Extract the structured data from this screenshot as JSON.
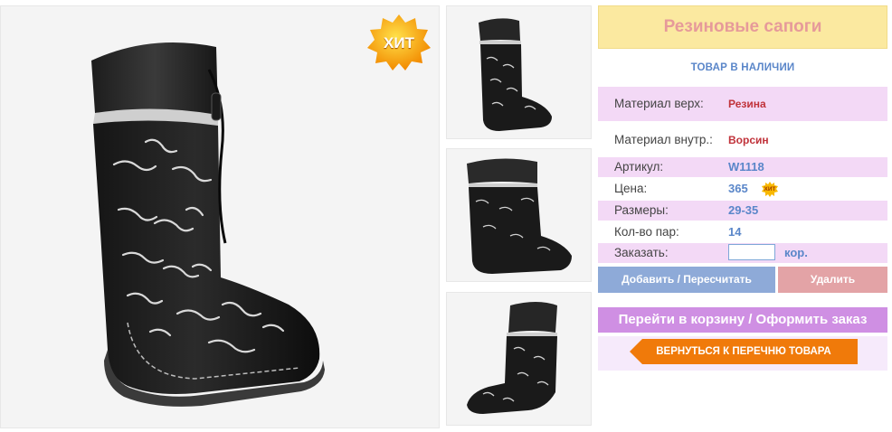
{
  "product": {
    "title": "Резиновые сапоги",
    "stock_status": "ТОВАР В НАЛИЧИИ",
    "hit_badge": "ХИТ",
    "main_image": "black-rubber-boot-dinosaur-print-photo",
    "thumbnails": [
      "boot-front-view",
      "boot-side-view",
      "boot-angle-view"
    ]
  },
  "specs": {
    "material_top_label": "Материал верх:",
    "material_top_value": "Резина",
    "material_inner_label": "Материал внутр.:",
    "material_inner_value": "Ворсин",
    "article_label": "Артикул:",
    "article_value": "W1118",
    "price_label": "Цена:",
    "price_value": "365",
    "price_badge": "ХИТ",
    "sizes_label": "Размеры:",
    "sizes_value": "29-35",
    "pairs_label": "Кол-во пар:",
    "pairs_value": "14",
    "order_label": "Заказать:",
    "order_input_value": "",
    "order_unit": "кор."
  },
  "buttons": {
    "add": "Добавить / Пересчитать",
    "delete": "Удалить",
    "cart": "Перейти в корзину / Оформить заказ",
    "back": "ВЕРНУТЬСЯ К ПЕРЕЧНЮ ТОВАРА"
  },
  "colors": {
    "title_bg": "#fbe9a0",
    "title_text": "#e69a9a",
    "row_pink": "#f3d9f6",
    "accent_blue": "#5a86c9",
    "value_red": "#c0323a",
    "add_button": "#8eaad8",
    "delete_button": "#e3a3a6",
    "cart_button": "#cf8fe3",
    "back_button": "#f07a0a"
  }
}
